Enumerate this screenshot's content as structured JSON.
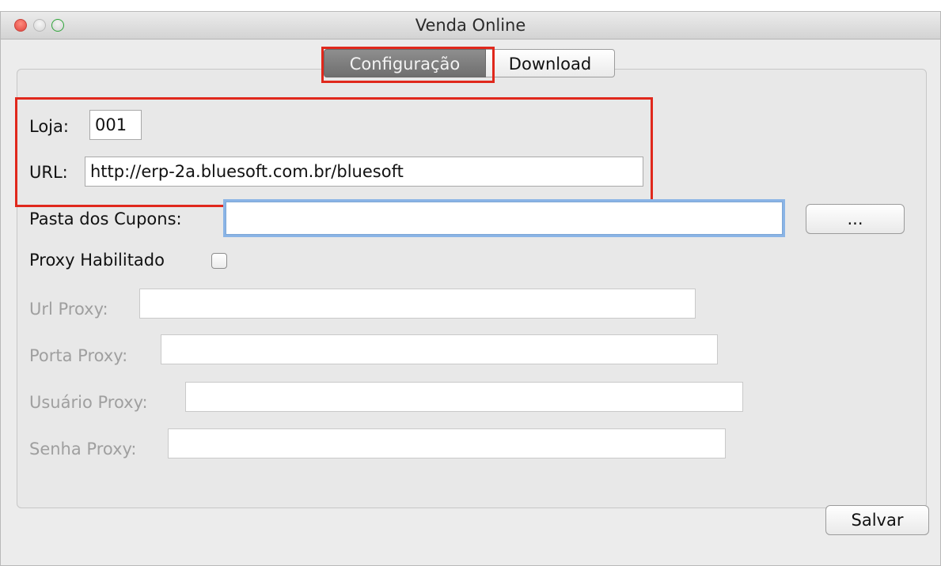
{
  "window": {
    "title": "Venda Online"
  },
  "tabs": [
    {
      "label": "Configuração",
      "active": true
    },
    {
      "label": "Download",
      "active": false
    }
  ],
  "form": {
    "loja": {
      "label": "Loja:",
      "value": "001"
    },
    "url": {
      "label": "URL:",
      "value": "http://erp-2a.bluesoft.com.br/bluesoft"
    },
    "pasta_cupons": {
      "label": "Pasta dos Cupons:",
      "value": "",
      "browse_label": "..."
    },
    "proxy_habilitado": {
      "label": "Proxy Habilitado",
      "checked": false
    },
    "url_proxy": {
      "label": "Url Proxy:",
      "value": ""
    },
    "porta_proxy": {
      "label": "Porta Proxy:",
      "value": ""
    },
    "usuario_proxy": {
      "label": "Usuário Proxy:",
      "value": ""
    },
    "senha_proxy": {
      "label": "Senha Proxy:",
      "value": ""
    }
  },
  "actions": {
    "save_label": "Salvar"
  },
  "colors": {
    "highlight": "#e0281c",
    "focus_ring": "#8ab4e6",
    "active_tab": "#7a7a7a"
  }
}
